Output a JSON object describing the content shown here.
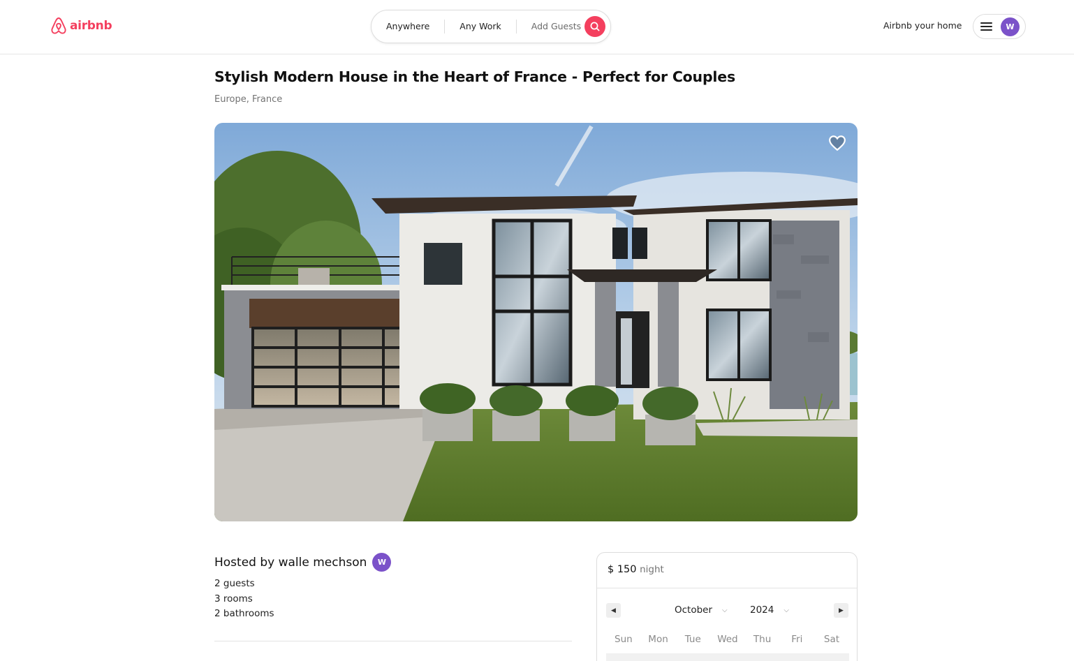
{
  "brand": {
    "name": "airbnb",
    "color": "#f43f5e"
  },
  "search": {
    "where": "Anywhere",
    "when": "Any Work",
    "guests": "Add Guests",
    "search_icon": "search-icon"
  },
  "nav": {
    "host_link": "Airbnb your home",
    "menu_icon": "hamburger-menu-icon",
    "avatar_initial": "W"
  },
  "listing": {
    "title": "Stylish Modern House in the Heart of France - Perfect for Couples",
    "location": "Europe, France",
    "favorite_icon": "heart-icon",
    "host": {
      "label": "Hosted by walle mechson",
      "avatar_initial": "W"
    },
    "details": [
      "2 guests",
      "3 rooms",
      "2 bathrooms"
    ]
  },
  "booking": {
    "price": "$ 150",
    "price_unit": "night",
    "calendar": {
      "month": "October",
      "year": "2024",
      "weekdays": [
        "Sun",
        "Mon",
        "Tue",
        "Wed",
        "Thu",
        "Fri",
        "Sat"
      ]
    }
  },
  "colors": {
    "accent": "#f43f5e",
    "avatar": "#7b52c9"
  }
}
